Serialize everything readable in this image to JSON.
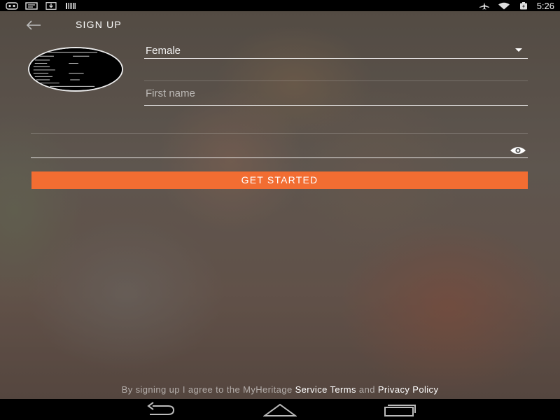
{
  "status_bar": {
    "left_icons": [
      "notification-game-icon",
      "notification-message-icon",
      "download-icon",
      "barcode-icon"
    ],
    "right_icons": [
      "airplane-mode-icon",
      "wifi-icon",
      "battery-icon"
    ],
    "time": "5:26"
  },
  "header": {
    "title": "SIGN UP",
    "back_icon": "arrow-left-icon"
  },
  "form": {
    "gender": {
      "selected": "Female"
    },
    "first_name": {
      "value": "",
      "placeholder": "First name"
    },
    "password": {
      "value": "",
      "placeholder": ""
    },
    "submit_label": "GET STARTED"
  },
  "footer": {
    "terms_prefix": "By signing up I agree to the MyHeritage ",
    "service_terms": "Service Terms",
    "terms_joiner": " and ",
    "privacy_policy": "Privacy Policy"
  },
  "nav_bar": {
    "buttons": [
      "nav-back-icon",
      "nav-home-icon",
      "nav-recents-icon"
    ]
  },
  "colors": {
    "accent": "#f26d32",
    "status_bar_bg": "#000000",
    "nav_bar_bg": "#000000"
  }
}
